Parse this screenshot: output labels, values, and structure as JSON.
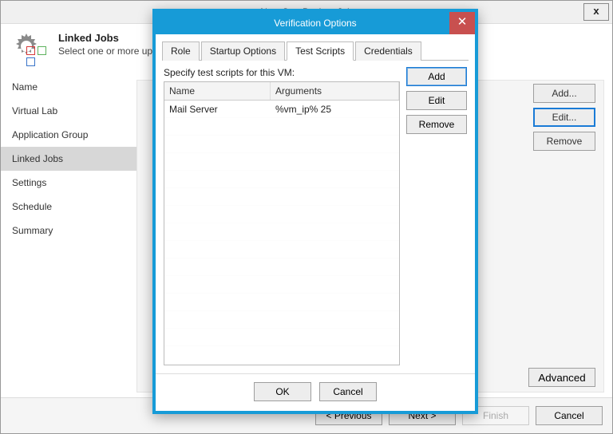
{
  "window": {
    "title": "New SureBackup Job",
    "close": "x"
  },
  "header": {
    "title": "Linked Jobs",
    "desc_visible": "Select one or more                                                                                                                   up jobs will be processed sequentially once t"
  },
  "sidebar": {
    "steps": [
      "Name",
      "Virtual Lab",
      "Application Group",
      "Linked Jobs",
      "Settings",
      "Schedule",
      "Summary"
    ],
    "selected_index": 3
  },
  "main_buttons": {
    "add": "Add...",
    "edit": "Edit...",
    "remove": "Remove",
    "advanced": "Advanced"
  },
  "footer": {
    "previous": "< Previous",
    "next": "Next >",
    "finish": "Finish",
    "cancel": "Cancel"
  },
  "dialog": {
    "title": "Verification Options",
    "tabs": [
      "Role",
      "Startup Options",
      "Test Scripts",
      "Credentials"
    ],
    "active_tab_index": 2,
    "specify_label": "Specify test scripts for this VM:",
    "grid": {
      "headers": {
        "name": "Name",
        "args": "Arguments"
      },
      "rows": [
        {
          "name": "Mail Server",
          "args": "%vm_ip% 25"
        }
      ]
    },
    "side_buttons": {
      "add": "Add",
      "edit": "Edit",
      "remove": "Remove"
    },
    "footer": {
      "ok": "OK",
      "cancel": "Cancel"
    }
  },
  "icon_boxes": [
    "#d63a3a",
    "#5db25d",
    "#3a74c9"
  ]
}
